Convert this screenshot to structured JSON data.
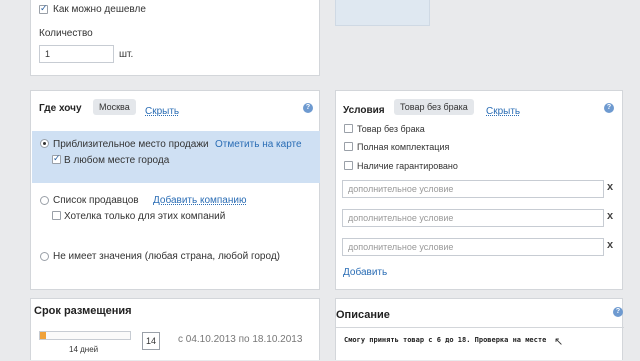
{
  "top": {
    "cheaper_label": "Как можно дешевле",
    "quantity_label": "Количество",
    "quantity_value": "1",
    "unit": "шт."
  },
  "where": {
    "title": "Где хочу",
    "city_tag": "Москва",
    "hide_link": "Скрыть",
    "approx_label": "Приблизительное место продажи",
    "map_link": "Отметить на карте",
    "anywhere_label": "В любом месте города",
    "sellers_label": "Список продавцов",
    "add_company_link": "Добавить компанию",
    "only_these_label": "Хотелка только для этих компаний",
    "no_matter_label": "Не имеет значения (любая страна, любой город)"
  },
  "conditions": {
    "title": "Условия",
    "tag": "Товар без брака",
    "hide_link": "Скрыть",
    "options": [
      "Товар без брака",
      "Полная комплектация",
      "Наличие гарантировано"
    ],
    "placeholder": "дополнительное условие",
    "remove": "x",
    "add_link": "Добавить"
  },
  "term": {
    "title": "Срок размещения",
    "days_label": "14 дней",
    "days_value": "14",
    "range": "с 04.10.2013 по 18.10.2013",
    "progress": 0.07
  },
  "description": {
    "title": "Описание",
    "text": "Смогу принять товар с 6 до 18. Проверка на месте"
  },
  "colors": {
    "accent": "#2a6db5",
    "selection": "#cfe0f3",
    "progress": "#f0a23a"
  }
}
